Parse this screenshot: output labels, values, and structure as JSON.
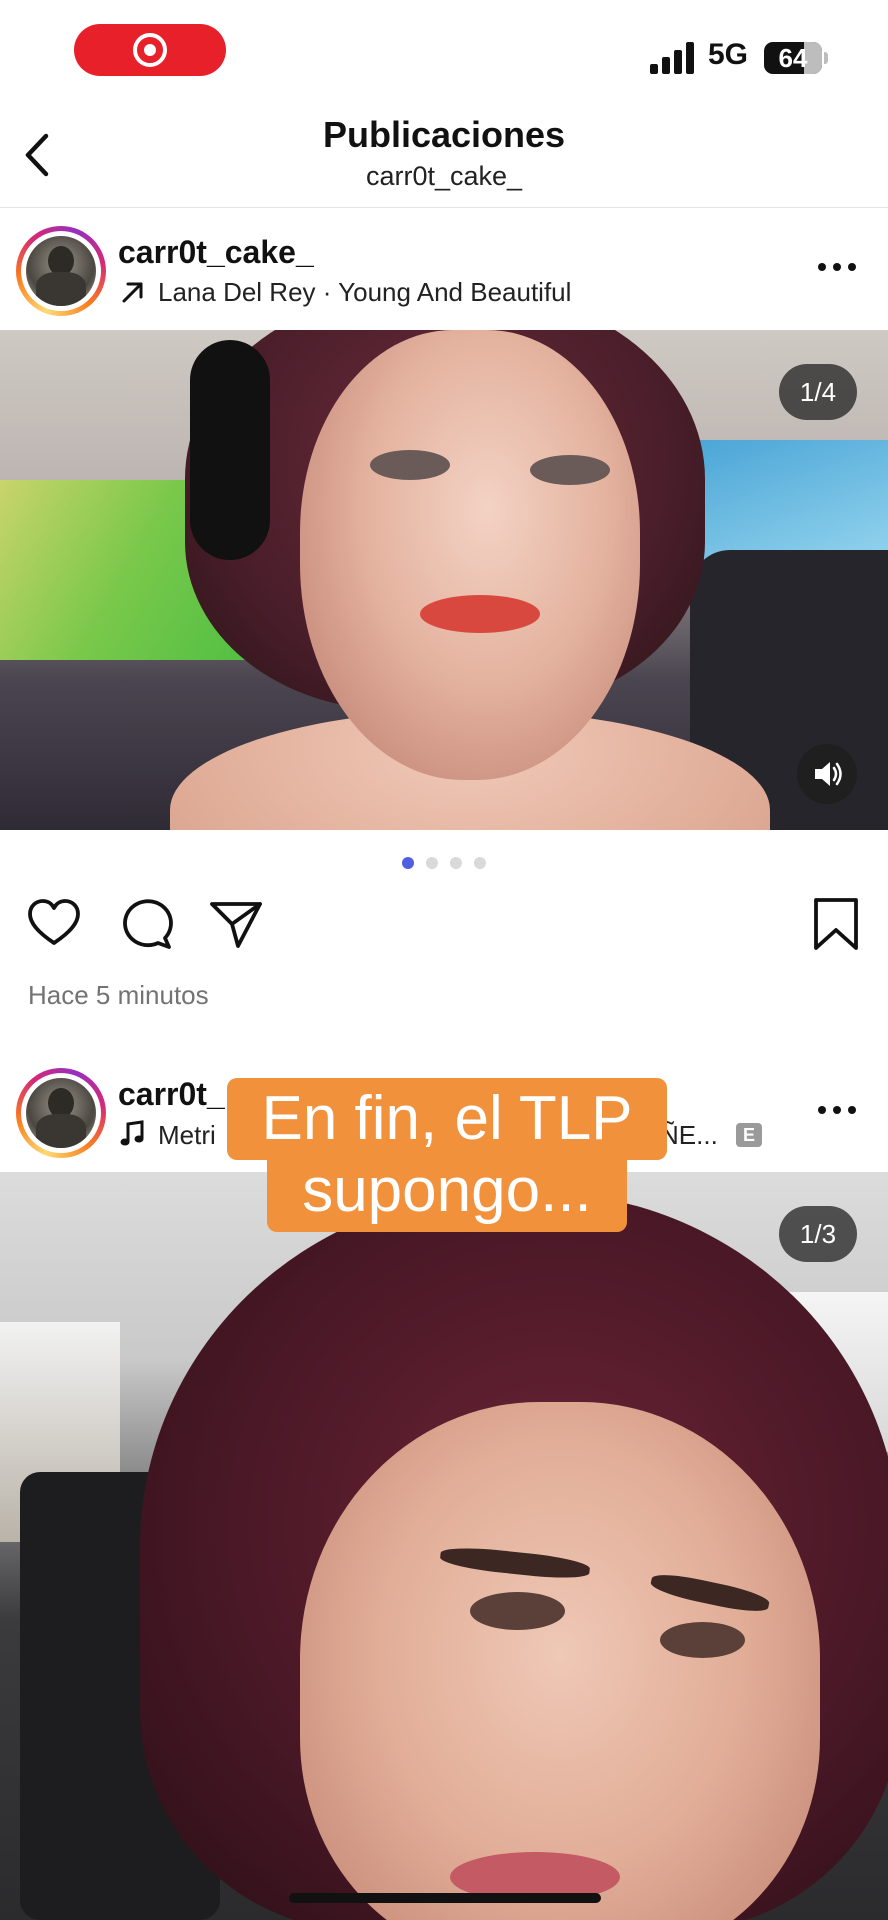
{
  "status_bar": {
    "network": "5G",
    "battery": "64",
    "recording_icon": "screen-record-icon",
    "signal_icon": "cellular-signal-icon"
  },
  "header": {
    "title": "Publicaciones",
    "subtitle": "carr0t_cake_",
    "back_icon": "chevron-left-icon"
  },
  "posts": [
    {
      "username": "carr0t_cake_",
      "music_icon": "arrow-up-right-icon",
      "music": "Lana Del Rey · Young And Beautiful",
      "counter": "1/4",
      "slide_count": 4,
      "active_slide": 1,
      "time_ago": "Hace 5 minutos",
      "sound_icon": "speaker-icon"
    },
    {
      "username_visible": "carr0t_",
      "music_icon": "music-note-icon",
      "music_visible_start": "Metri",
      "music_visible_end": "ÑE...",
      "explicit_badge": "E",
      "counter": "1/3",
      "caption_overlay": [
        "En fin, el TLP",
        "supongo..."
      ]
    }
  ],
  "actions": {
    "like_icon": "heart-icon",
    "comment_icon": "comment-bubble-icon",
    "share_icon": "paper-plane-icon",
    "save_icon": "bookmark-icon",
    "more_icon": "more-horizontal-icon"
  },
  "colors": {
    "accent_dot": "#4f5fe0",
    "caption_bg": "#f2913b",
    "record_pill": "#e8202a",
    "muted_text": "#737373"
  }
}
